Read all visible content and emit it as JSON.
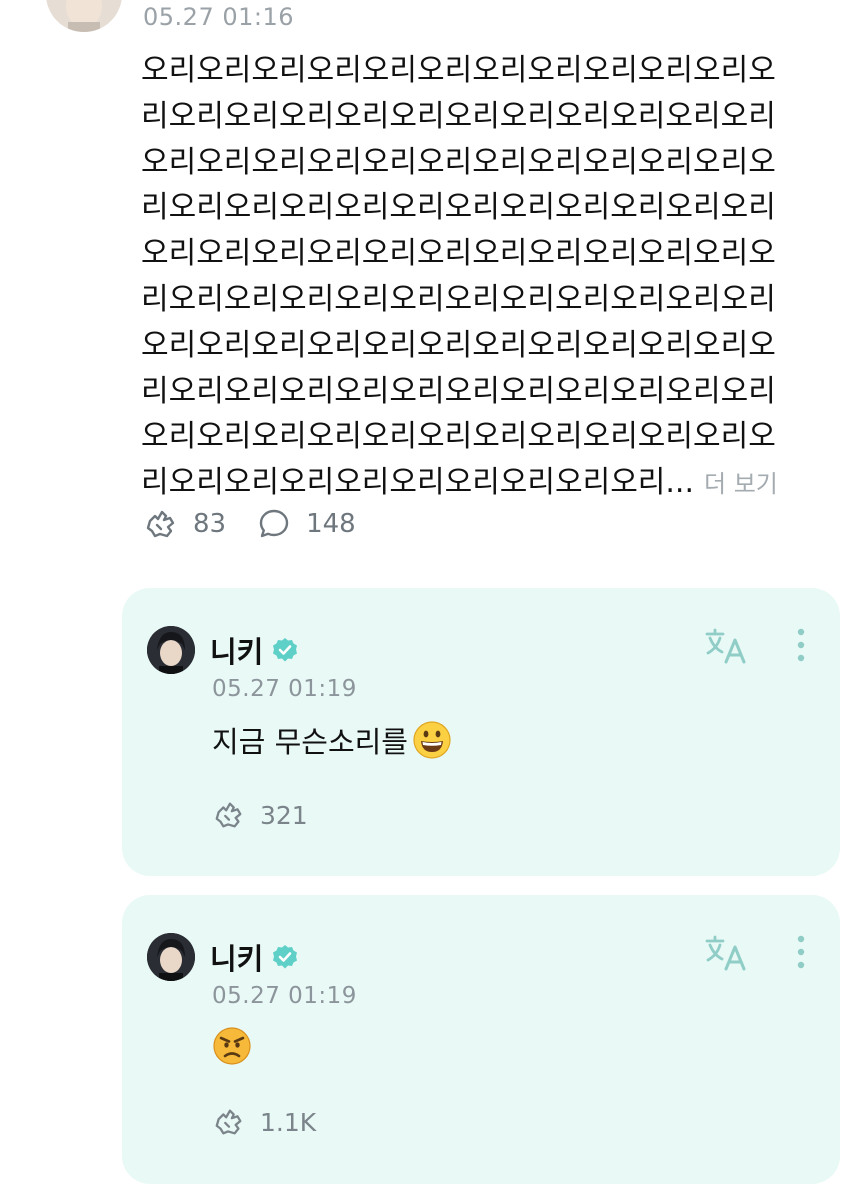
{
  "post": {
    "time": "05.27 01:16",
    "lines": [
      "오리오리오리오리오리오리오리오리오리오리오리오",
      "리오리오리오리오리오리오리오리오리오리오리오리",
      "오리오리오리오리오리오리오리오리오리오리오리오",
      "리오리오리오리오리오리오리오리오리오리오리오리",
      "오리오리오리오리오리오리오리오리오리오리오리오",
      "리오리오리오리오리오리오리오리오리오리오리오리",
      "오리오리오리오리오리오리오리오리오리오리오리오",
      "리오리오리오리오리오리오리오리오리오리오리오리",
      "오리오리오리오리오리오리오리오리오리오리오리오",
      "리오리오리오리오리오리오리오리오리오리..."
    ],
    "more_label": "더 보기",
    "like_count": "83",
    "comment_count": "148"
  },
  "comments": [
    {
      "name": "니키",
      "time": "05.27 01:19",
      "text": "지금 무슨소리를",
      "emoji": "grinning-face",
      "like_count": "321"
    },
    {
      "name": "니키",
      "time": "05.27 01:19",
      "text": "",
      "emoji": "angry-face",
      "like_count": "1.1K"
    }
  ],
  "colors": {
    "card_bg": "#e9f9f6",
    "accent": "#5fd0c7",
    "muted_text": "#9aa1a7"
  }
}
